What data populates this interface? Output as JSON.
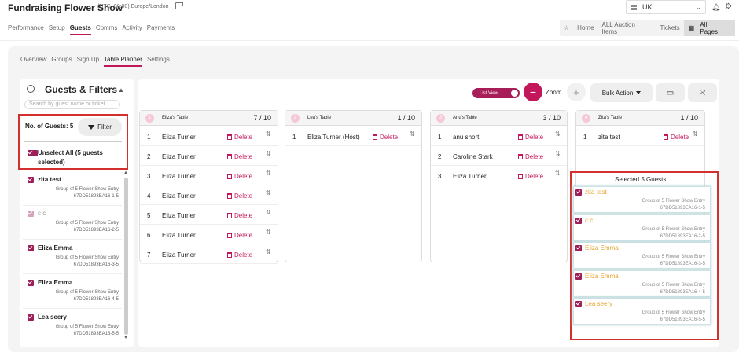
{
  "header": {
    "title": "Fundraising Flower Show",
    "timezone": "(UTC+00:00) Europe/London",
    "country": "UK"
  },
  "nav": {
    "items": [
      "Performance",
      "Setup",
      "Guests",
      "Comms",
      "Activity",
      "Payments"
    ],
    "active": "Guests"
  },
  "right_nav": {
    "items": [
      "Home",
      "ALL Auction Items",
      "Tickets"
    ],
    "all_pages": "All Pages"
  },
  "sub_tabs": {
    "items": [
      "Overview",
      "Groups",
      "Sign Up",
      "Table Planner",
      "Settings"
    ],
    "active": "Table Planner"
  },
  "left_panel": {
    "title": "Guests & Filters",
    "search_placeholder": "Search by guest name or ticket",
    "no_of_guests": "No. of Guests: 5",
    "filter_label": "Filter",
    "unselect_all": "Unselect All (5 guests selected)",
    "guests": [
      {
        "name": "zita test",
        "group": "Group of 5 Flower Show Entry",
        "code": "67DD51893EA16-1-5",
        "faded": false
      },
      {
        "name": "c c",
        "group": "Group of 5 Flower Show Entry",
        "code": "67DD51893EA16-2-5",
        "faded": true
      },
      {
        "name": "Eliza Emma",
        "group": "Group of 5 Flower Show Entry",
        "code": "67DD51893EA16-3-5",
        "faded": false
      },
      {
        "name": "Eliza Emma",
        "group": "Group of 5 Flower Show Entry",
        "code": "67DD51893EA16-4-5",
        "faded": false
      },
      {
        "name": "Lea seery",
        "group": "Group of 5 Flower Show Entry",
        "code": "67DD51893EA16-5-5",
        "faded": false
      }
    ]
  },
  "toolbar": {
    "list_view": "List View",
    "zoom_out": "−",
    "zoom": "Zoom",
    "zoom_in": "+",
    "bulk_action": "Bulk Action"
  },
  "tables": [
    {
      "num": "1",
      "name": "Eliza's Table",
      "count": "7 / 10",
      "rows": [
        {
          "n": "1",
          "name": "Eliza Turner"
        },
        {
          "n": "2",
          "name": "Eliza Turner"
        },
        {
          "n": "3",
          "name": "Eliza Turner"
        },
        {
          "n": "4",
          "name": "Eliza Turner"
        },
        {
          "n": "5",
          "name": "Eliza Turner"
        },
        {
          "n": "6",
          "name": "Eliza Turner"
        },
        {
          "n": "7",
          "name": "Eliza Turner"
        }
      ]
    },
    {
      "num": "2",
      "name": "Lea's Table",
      "count": "1 / 10",
      "rows": [
        {
          "n": "1",
          "name": "Eliza Turner (Host)"
        }
      ]
    },
    {
      "num": "3",
      "name": "Anu's Table",
      "count": "3 / 10",
      "rows": [
        {
          "n": "1",
          "name": "anu short"
        },
        {
          "n": "2",
          "name": "Caroline Stark"
        },
        {
          "n": "3",
          "name": "Eliza Turner"
        }
      ]
    },
    {
      "num": "4",
      "name": "Zita's Table",
      "count": "1 / 10",
      "rows": [
        {
          "n": "1",
          "name": "zita test"
        }
      ]
    }
  ],
  "delete_label": "Delete",
  "selected_panel": {
    "title": "Selected 5 Guests",
    "guests": [
      {
        "name": "zita test",
        "group": "Group of 5 Flower Show Entry",
        "code": "67DD51893EA16-1-5"
      },
      {
        "name": "c c",
        "group": "Group of 5 Flower Show Entry",
        "code": "67DD51893EA16-2-5"
      },
      {
        "name": "Eliza Emma",
        "group": "Group of 5 Flower Show Entry",
        "code": "67DD51893EA16-3-5"
      },
      {
        "name": "Eliza Emma",
        "group": "Group of 5 Flower Show Entry",
        "code": "67DD51893EA16-4-5"
      },
      {
        "name": "Lea seery",
        "group": "Group of 5 Flower Show Entry",
        "code": "67DD51893EA16-5-5"
      }
    ]
  },
  "colors": {
    "accent": "#c2185b",
    "highlight": "#d32f2f",
    "selected_name": "#e8a32e"
  }
}
